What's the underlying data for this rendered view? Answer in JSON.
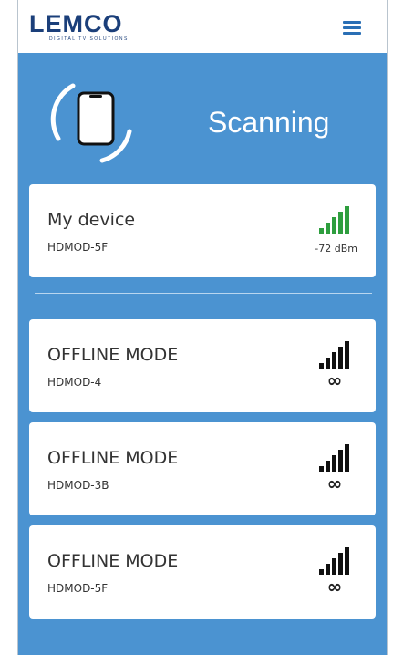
{
  "app": {
    "logo_text": "LEMCO",
    "logo_tagline": "DIGITAL TV SOLUTIONS"
  },
  "scan": {
    "status_label": "Scanning"
  },
  "my_device": {
    "title": "My device",
    "model": "HDMOD-5F",
    "signal_text": "-72 dBm",
    "signal_color": "#2e9e3e"
  },
  "offline_devices": [
    {
      "title": "OFFLINE MODE",
      "model": "HDMOD-4",
      "symbol": "∞"
    },
    {
      "title": "OFFLINE MODE",
      "model": "HDMOD-3B",
      "symbol": "∞"
    },
    {
      "title": "OFFLINE MODE",
      "model": "HDMOD-5F",
      "symbol": "∞"
    }
  ],
  "colors": {
    "background": "#4b93d1",
    "brand": "#1b3f7a",
    "menu": "#2a6fb5"
  }
}
